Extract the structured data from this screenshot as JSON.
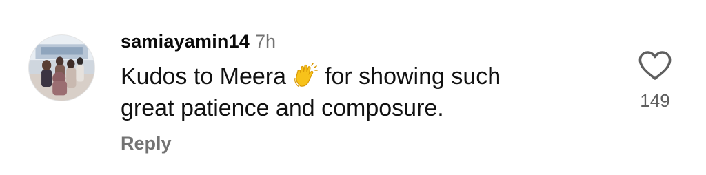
{
  "comment": {
    "avatar_icon": "user-avatar-photo",
    "username": "samiayamin14",
    "time": "7h",
    "text_line1_before_emoji": "Kudos to Meera",
    "emoji_icon": "clapping-hands-icon",
    "text_line1_after_emoji": "for showing such",
    "text_line2": "great patience and composure.",
    "reply_label": "Reply",
    "like_icon": "heart-outline-icon",
    "like_count": "149"
  },
  "colors": {
    "username": "#0a0a0a",
    "time": "#737373",
    "reply": "#737373",
    "like_count": "#5f5f5f",
    "emoji": "#f7c21a"
  }
}
